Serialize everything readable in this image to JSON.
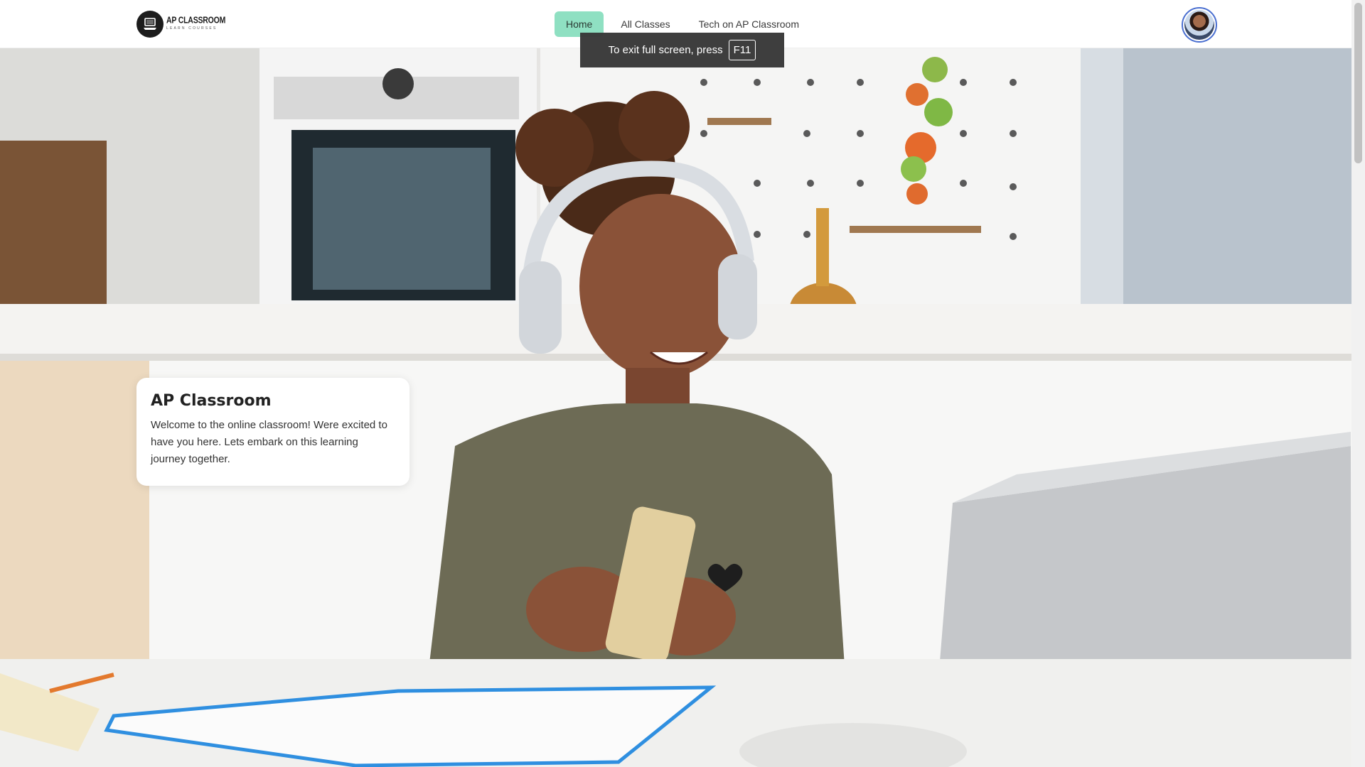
{
  "navbar": {
    "logo": {
      "title": "AP CLASSROOM",
      "subtitle": "LEARN COURSES"
    },
    "links": [
      {
        "label": "Home",
        "active": true
      },
      {
        "label": "All Classes",
        "active": false
      },
      {
        "label": "Tech on AP Classroom",
        "active": false
      }
    ],
    "active_color": "#8fe0c2"
  },
  "fullscreen_toast": {
    "message": "To exit full screen, press",
    "key": "F11"
  },
  "hero": {
    "image_description_icon": "hero-photo"
  },
  "welcome_card": {
    "title": "AP Classroom",
    "text": "Welcome to the online classroom! Were excited to have you here. Lets embark on this learning journey together."
  },
  "icons": {
    "logo": "laptop-logo-icon",
    "avatar": "user-avatar"
  }
}
